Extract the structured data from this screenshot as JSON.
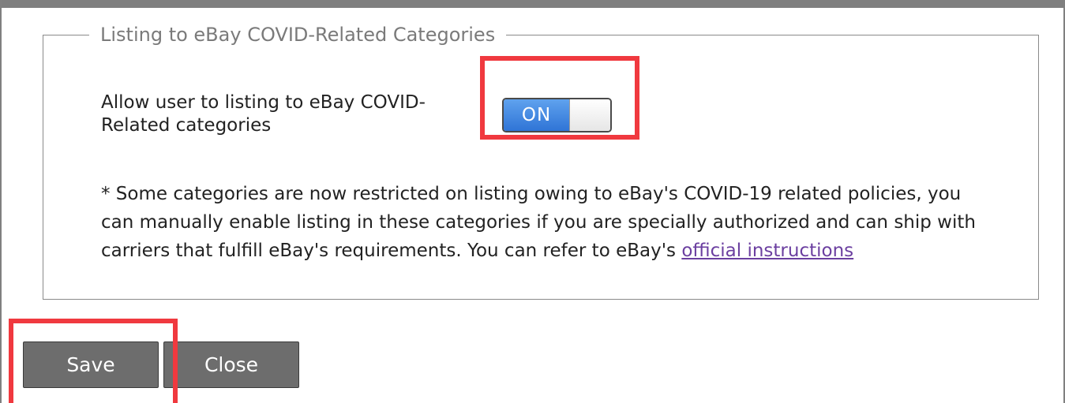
{
  "section": {
    "legend": "Listing to eBay COVID-Related Categories"
  },
  "setting": {
    "label_line1": "Allow user to listing to eBay COVID-",
    "label_line2": "Related categories",
    "toggle_label": "ON",
    "toggle_state": "on"
  },
  "note": {
    "text": "*  Some categories are now restricted on listing owing to eBay's COVID-19 related policies, you can manually enable listing in these categories if you are specially authorized and can ship with carriers that fulfill eBay's requirements. You can refer to eBay's ",
    "link_text": "official instructions"
  },
  "buttons": {
    "save_label": "Save",
    "close_label": "Close"
  },
  "colors": {
    "highlight": "#f0393f",
    "toggle_on": "#2f74d6",
    "button_bg": "#6d6d6d",
    "link": "#6b3fa0"
  }
}
